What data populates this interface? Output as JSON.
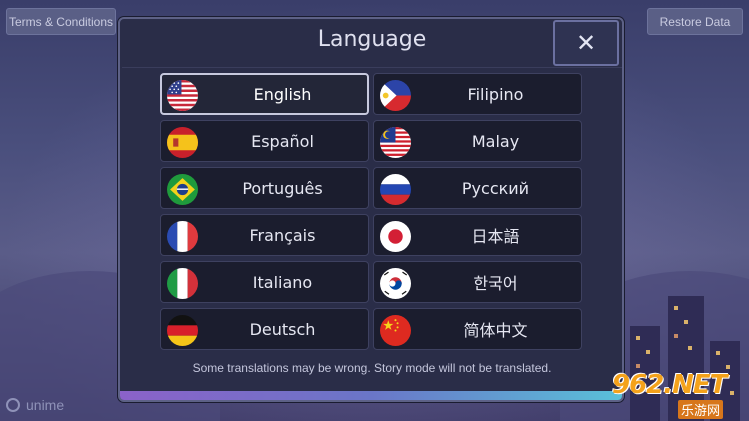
{
  "header": {
    "terms_label": "Terms & Conditions",
    "restore_label": "Restore Data"
  },
  "dialog": {
    "title": "Language",
    "close_label": "✕",
    "note": "Some translations may be wrong. Story mode will not be translated.",
    "selected": "English",
    "languages": [
      {
        "label": "English",
        "flag": "usa-flag-icon"
      },
      {
        "label": "Filipino",
        "flag": "philippines-flag-icon"
      },
      {
        "label": "Español",
        "flag": "spain-flag-icon"
      },
      {
        "label": "Malay",
        "flag": "malaysia-flag-icon"
      },
      {
        "label": "Português",
        "flag": "brazil-flag-icon"
      },
      {
        "label": "Русский",
        "flag": "russia-flag-icon"
      },
      {
        "label": "Français",
        "flag": "france-flag-icon"
      },
      {
        "label": "日本語",
        "flag": "japan-flag-icon"
      },
      {
        "label": "Italiano",
        "flag": "italy-flag-icon"
      },
      {
        "label": "한국어",
        "flag": "korea-flag-icon"
      },
      {
        "label": "Deutsch",
        "flag": "germany-flag-icon"
      },
      {
        "label": "简体中文",
        "flag": "china-flag-icon"
      }
    ]
  },
  "footer": {
    "logo_text": "unime"
  },
  "watermark": {
    "main": "962.NET",
    "sub": "乐游网"
  },
  "colors": {
    "panel": "#2a2d48",
    "button": "#1b1d2e",
    "accent_start": "#8b62c9",
    "accent_end": "#59c1d9",
    "watermark": "#f4a21b"
  }
}
